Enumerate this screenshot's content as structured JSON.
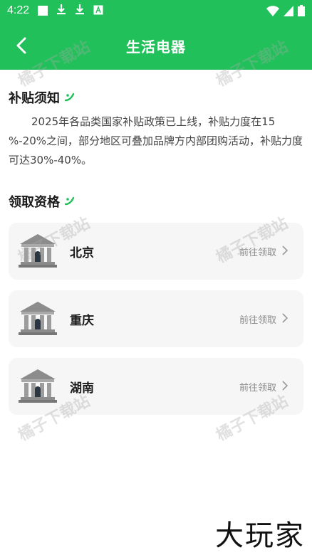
{
  "status_bar": {
    "time": "4:22",
    "icons": [
      "notification-square-icon",
      "download-icon",
      "download-icon",
      "a-badge-icon",
      "wifi-icon",
      "signal-icon",
      "battery-icon"
    ]
  },
  "header": {
    "title": "生活电器",
    "back_icon": "chevron-left-icon"
  },
  "notice_section": {
    "title": "补贴须知",
    "body": "2025年各品类国家补贴政策已上线，补贴力度在15 %-20%之间，部分地区可叠加品牌方内部团购活动，补贴力度可达30%-40%。"
  },
  "eligibility_section": {
    "title": "领取资格",
    "items": [
      {
        "city": "北京",
        "action": "前往领取"
      },
      {
        "city": "重庆",
        "action": "前往领取"
      },
      {
        "city": "湖南",
        "action": "前往领取"
      }
    ]
  },
  "watermark_text": "橘子下载站",
  "brand_text": "大玩家",
  "colors": {
    "primary_green": "#21c05a",
    "card_bg": "#f6f6f6",
    "muted_text": "#8a8a8a"
  }
}
